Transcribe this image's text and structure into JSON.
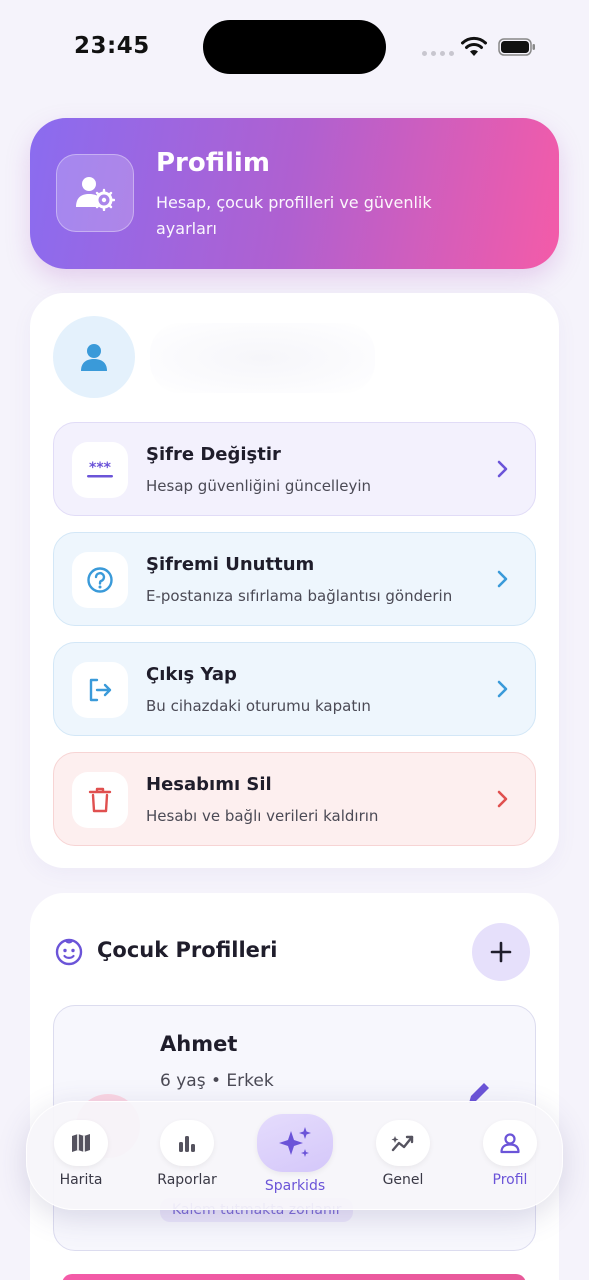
{
  "status_bar": {
    "time": "23:45"
  },
  "header": {
    "title": "Profilim",
    "subtitle": "Hesap, çocuk profilleri ve güvenlik ayarları"
  },
  "account": {
    "actions": [
      {
        "title": "Şifre Değiştir",
        "subtitle": "Hesap güvenliğini güncelleyin",
        "icon": "password-icon",
        "tone": "purple"
      },
      {
        "title": "Şifremi Unuttum",
        "subtitle": "E-postanıza sıfırlama bağlantısı gönderin",
        "icon": "question-icon",
        "tone": "blue"
      },
      {
        "title": "Çıkış Yap",
        "subtitle": "Bu cihazdaki oturumu kapatın",
        "icon": "logout-icon",
        "tone": "blue"
      },
      {
        "title": "Hesabımı Sil",
        "subtitle": "Hesabı ve bağlı verileri kaldırın",
        "icon": "trash-icon",
        "tone": "red"
      }
    ]
  },
  "children": {
    "title": "Çocuk Profilleri",
    "items": [
      {
        "name": "Ahmet",
        "meta": "6 yaş • Erkek",
        "tag": "Kalem tutmakta zorlanır"
      }
    ]
  },
  "nav": {
    "items": [
      {
        "label": "Harita",
        "icon": "map-icon"
      },
      {
        "label": "Raporlar",
        "icon": "bar-chart-icon"
      },
      {
        "label": "Sparkids",
        "icon": "sparkles-icon"
      },
      {
        "label": "Genel",
        "icon": "trend-icon"
      },
      {
        "label": "Profil",
        "icon": "user-icon"
      }
    ],
    "active": "Profil"
  },
  "colors": {
    "accent": "#6b54d8",
    "header_gradient_start": "#8a6cf0",
    "header_gradient_end": "#f45ba8",
    "danger": "#e0504f",
    "info": "#3a9ad9"
  }
}
